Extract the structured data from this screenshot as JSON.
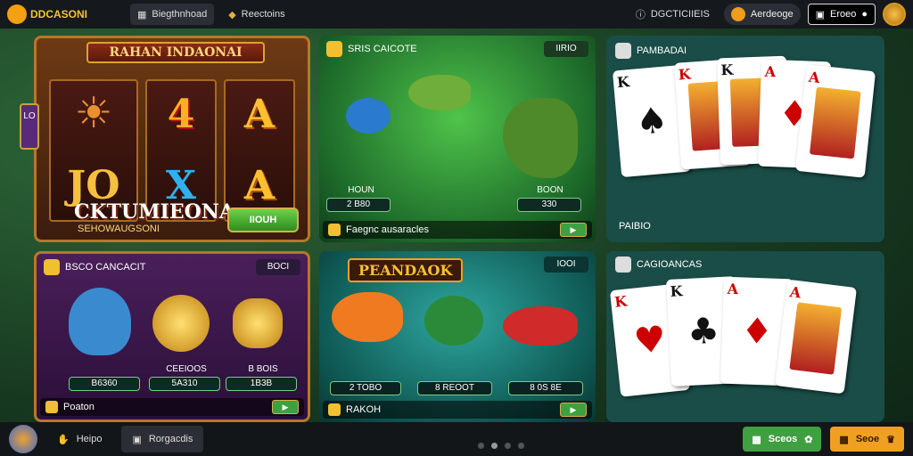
{
  "topbar": {
    "logo": "DDCASONI",
    "tab1": "Biegthnhoad",
    "tab2": "Reectoins",
    "info_label": "DGCTICIIEIS",
    "pill_label": "Aerdeoge",
    "balance_label": "Eroeo"
  },
  "slot": {
    "title": "RAHAN INDAONAI",
    "symbols": [
      "4",
      "A",
      "JO",
      "X",
      "A"
    ],
    "big_text": "CKTUMIEONA",
    "sub_text": "SEHOWAUGSONI",
    "button": "IIOUH",
    "side_tab": "LO"
  },
  "fish1": {
    "title": "SRIS CAICOTE",
    "badge": "IIRIO",
    "stat1_label": "HOUN",
    "stat1_value": "2 B80",
    "stat2_label": "BOON",
    "stat2_value": "330",
    "footer": "Faegnc ausaracles"
  },
  "coins": {
    "title": "BSCO CANCACIT",
    "badge": "BOCI",
    "stats": [
      {
        "label": "",
        "value": "B6360"
      },
      {
        "label": "CEEIOOS",
        "value": "5A310"
      },
      {
        "label": "B BOIS",
        "value": "1B3B"
      }
    ],
    "footer": "Poaton"
  },
  "fish2": {
    "title": "PEANDAOK",
    "badge": "IOOI",
    "stats": [
      "2 TOBO",
      "8 REOOT",
      "8 0S 8E"
    ],
    "footer": "RAKOH"
  },
  "cards1": {
    "title": "PAMBADAI",
    "footer": "PAIBIO"
  },
  "cards2": {
    "title": "CAGIOANCAS"
  },
  "bottombar": {
    "tab1": "Heipo",
    "tab2": "Rorgacdis",
    "btn_green": "Sceos",
    "btn_orange": "Seoe"
  },
  "colors": {
    "accent_gold": "#f4c430",
    "green": "#3fa040",
    "orange": "#f0a020"
  }
}
